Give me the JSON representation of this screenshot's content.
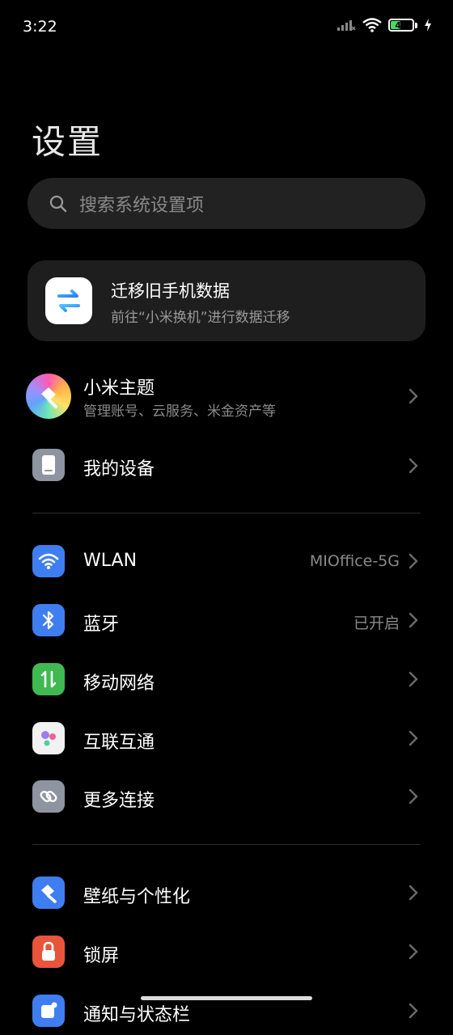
{
  "status_bar": {
    "time": "3:22",
    "battery_level": "47",
    "battery_fraction": 0.47
  },
  "page": {
    "title": "设置"
  },
  "search": {
    "placeholder": "搜索系统设置项"
  },
  "migrate_card": {
    "title": "迁移旧手机数据",
    "subtitle": "前往“小米换机”进行数据迁移"
  },
  "account": {
    "label": "小米主题",
    "subtitle": "管理账号、云服务、米金资产等"
  },
  "device": {
    "label": "我的设备"
  },
  "connectivity": {
    "wlan": {
      "label": "WLAN",
      "value": "MIOffice-5G"
    },
    "bluetooth": {
      "label": "蓝牙",
      "value": "已开启"
    },
    "mobile_network": {
      "label": "移动网络"
    },
    "interconnect": {
      "label": "互联互通"
    },
    "more_connections": {
      "label": "更多连接"
    }
  },
  "personalization": {
    "wallpaper": {
      "label": "壁纸与个性化"
    },
    "lock_screen": {
      "label": "锁屏"
    },
    "notifications": {
      "label": "通知与状态栏"
    }
  },
  "colors": {
    "wlan_icon_bg": "#3f7ef0",
    "bluetooth_icon_bg": "#3f7ef0",
    "mobile_icon_bg": "#3fb950",
    "lock_icon_bg": "#e8553a",
    "battery_fill": "#4bd964"
  }
}
